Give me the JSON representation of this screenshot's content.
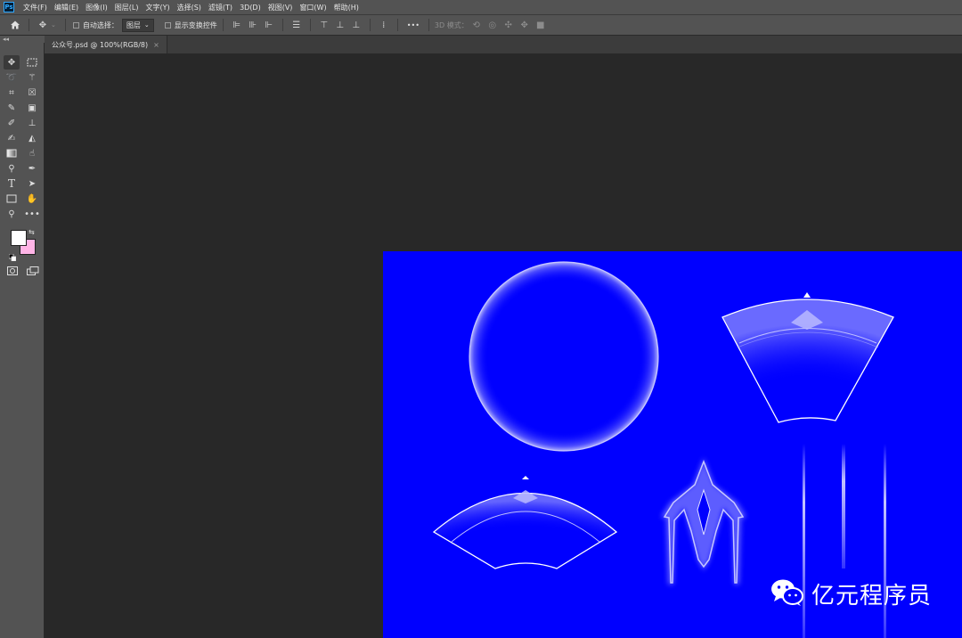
{
  "app": {
    "logo": "Ps"
  },
  "menu": [
    "文件(F)",
    "编辑(E)",
    "图像(I)",
    "图层(L)",
    "文字(Y)",
    "选择(S)",
    "滤镜(T)",
    "3D(D)",
    "视图(V)",
    "窗口(W)",
    "帮助(H)"
  ],
  "options": {
    "auto_select_label": "自动选择：",
    "auto_select_value": "图层",
    "show_transform_label": "显示变换控件",
    "more_label": "•••",
    "mode_3d_label": "3D 模式："
  },
  "document_tab": {
    "title": "公众号.psd @ 100%(RGB/8)",
    "close": "×"
  },
  "toolbar": {
    "collapse": "◂◂",
    "icons": [
      "move-icon",
      "marquee-icon",
      "lasso-icon",
      "magic-wand-icon",
      "crop-icon",
      "frame-icon",
      "eyedropper-icon",
      "spot-heal-icon",
      "brush-icon",
      "stamp-icon",
      "history-brush-icon",
      "eraser-icon",
      "gradient-icon",
      "smudge-icon",
      "dodge-icon",
      "pen-icon",
      "type-icon",
      "path-select-icon",
      "rectangle-icon",
      "hand-icon",
      "zoom-icon",
      "more-tools-icon"
    ]
  },
  "colors": {
    "foreground": "#ffffff",
    "background": "#ffb4e6",
    "canvas": "#0000ff"
  },
  "canvas_text": {
    "watermark": "亿元程序员"
  }
}
